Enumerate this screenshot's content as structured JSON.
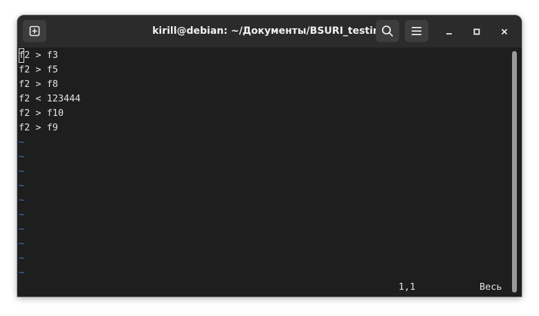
{
  "window": {
    "title": "kirill@debian: ~/Документы/BSURI_testing"
  },
  "titlebar": {
    "icons": [
      "new-tab-icon",
      "search-icon",
      "menu-icon",
      "minimize-icon",
      "maximize-icon",
      "close-icon"
    ]
  },
  "terminal": {
    "cursor_char": "f",
    "first_line_rest": "2 > f3",
    "lines": [
      "f2 > f5",
      "f2 > f8",
      "f2 < 123444",
      "f2 > f10",
      "f2 > f9"
    ],
    "tilde": "~",
    "status_position": "1,1",
    "status_mode": "Весь"
  },
  "colors": {
    "background": "#1e1e1e",
    "titlebar": "#2b2b2b",
    "text": "#e5e5e5",
    "tilde": "#3a7fd0"
  }
}
